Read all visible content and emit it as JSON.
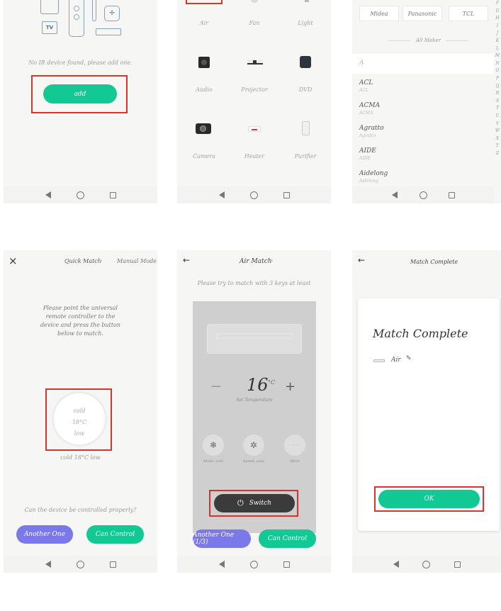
{
  "panel1": {
    "tv_label": "TV",
    "message": "No IR device found, please add one.",
    "add_button": "add"
  },
  "panel2": {
    "devices": [
      {
        "label": "Air",
        "icon": "air-conditioner-icon"
      },
      {
        "label": "Fan",
        "icon": "fan-icon"
      },
      {
        "label": "Light",
        "icon": "light-icon"
      },
      {
        "label": "Audio",
        "icon": "audio-icon"
      },
      {
        "label": "Projector",
        "icon": "projector-icon"
      },
      {
        "label": "DVD",
        "icon": "dvd-icon"
      },
      {
        "label": "Camera",
        "icon": "camera-icon"
      },
      {
        "label": "Heater",
        "icon": "heater-icon"
      },
      {
        "label": "Purifier",
        "icon": "purifier-icon"
      }
    ]
  },
  "panel3": {
    "top_brands": [
      "Midea",
      "Panasonic",
      "TCL"
    ],
    "all_maker_label": "All Maker",
    "section_letter": "A",
    "brands": [
      {
        "name": "ACL",
        "sub": "ACL"
      },
      {
        "name": "ACMA",
        "sub": "ACMA"
      },
      {
        "name": "Agratto",
        "sub": "Agratto"
      },
      {
        "name": "AIDE",
        "sub": "AIDE"
      },
      {
        "name": "Aidelong",
        "sub": "Aidelong"
      }
    ],
    "alphabet": [
      "F",
      "G",
      "H",
      "I",
      "J",
      "K",
      "L",
      "M",
      "N",
      "O",
      "P",
      "Q",
      "R",
      "S",
      "T",
      "U",
      "V",
      "W",
      "X",
      "Y",
      "Z"
    ]
  },
  "panel4": {
    "close_icon": "×",
    "tab_quick": "Quick Match",
    "tab_manual": "Manual Mode",
    "instruction": "Please point the universal remote controller to the device and press the button below to match.",
    "circle_lines": [
      "cold",
      "18°C",
      "low"
    ],
    "circle_caption": "cold 18°C low",
    "question": "Can the device be controlled properly?",
    "another_button": "Another One",
    "can_control_button": "Can Control"
  },
  "panel5": {
    "back_icon": "←",
    "title": "Air Match",
    "subtitle": "Please try to match with 3 keys at least",
    "temperature": "16",
    "unit": "°C",
    "set_temp_label": "Set Temperature",
    "minus": "—",
    "plus": "+",
    "modes": [
      {
        "label": "Mode: cold",
        "icon": "snowflake-icon",
        "glyph": "❄"
      },
      {
        "label": "Speed: auto",
        "icon": "fan-speed-icon",
        "glyph": "✲"
      },
      {
        "label": "More",
        "icon": "more-icon",
        "glyph": "···"
      }
    ],
    "switch_label": "Switch",
    "another_button": "Another One (1/3)",
    "can_control_button": "Can Control"
  },
  "panel6": {
    "back_icon": "←",
    "header_title": "Match Complete",
    "card_title": "Match Complete",
    "device_name": "Air",
    "ok_button": "OK"
  }
}
